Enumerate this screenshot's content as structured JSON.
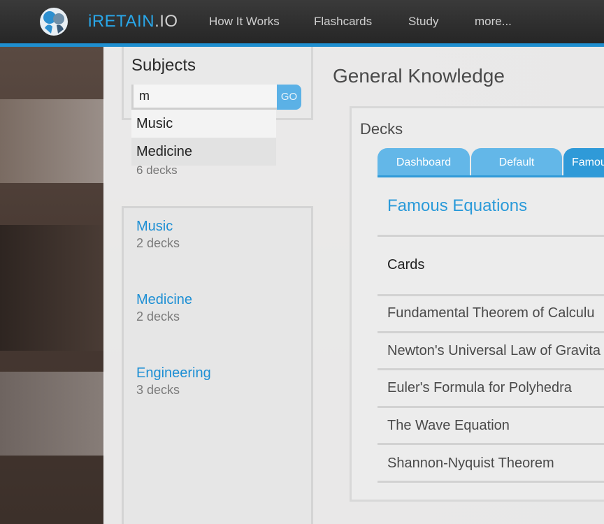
{
  "header": {
    "brand_part1": "iRETAIN",
    "brand_part2": ".IO",
    "nav": [
      "How It Works",
      "Flashcards",
      "Study",
      "more..."
    ]
  },
  "sidebar": {
    "subjects_title": "Subjects",
    "search": {
      "value": "m",
      "go_label": "GO"
    },
    "suggestions": [
      "Music",
      "Medicine"
    ],
    "hidden_count": "6 decks",
    "subjects": [
      {
        "name": "Music",
        "count": "2 decks"
      },
      {
        "name": "Medicine",
        "count": "2 decks"
      },
      {
        "name": "Engineering",
        "count": "3 decks"
      }
    ]
  },
  "main": {
    "title": "General Knowledge",
    "decks_title": "Decks",
    "tabs": [
      "Dashboard",
      "Default",
      "Famou"
    ],
    "deck_name": "Famous Equations",
    "cards_label": "Cards",
    "cards": [
      "Fundamental Theorem of Calculu",
      "Newton's Universal Law of Gravita",
      "Euler's Formula for Polyhedra",
      "The Wave Equation",
      "Shannon-Nyquist Theorem"
    ]
  },
  "colors": {
    "accent": "#1f8fd0",
    "tab": "#63b7e8",
    "link": "#1d8fd4"
  }
}
